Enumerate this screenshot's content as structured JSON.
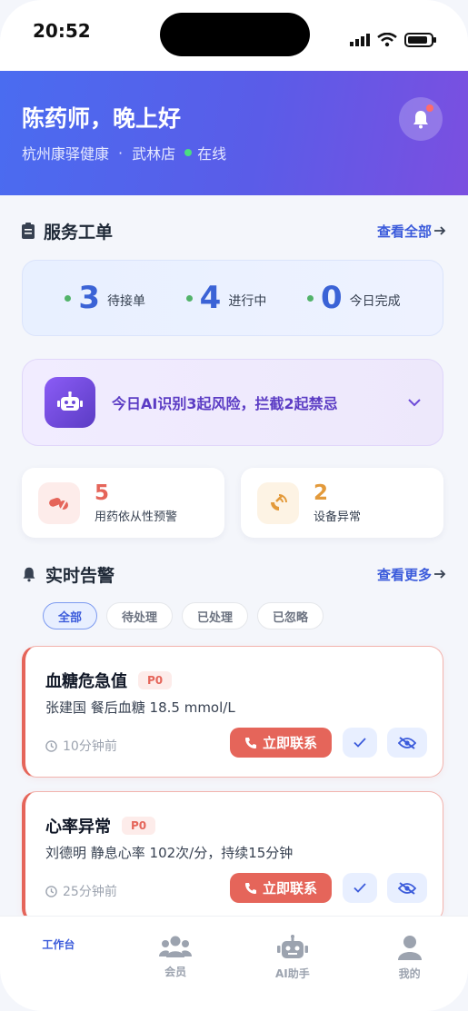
{
  "status_bar": {
    "time": "20:52"
  },
  "header": {
    "greeting": "陈药师，晚上好",
    "company": "杭州康驿健康",
    "separator": "·",
    "store": "武林店",
    "online": "在线"
  },
  "service": {
    "title": "服务工单",
    "link": "查看全部",
    "stats": [
      {
        "value": "3",
        "label": "待接单"
      },
      {
        "value": "4",
        "label": "进行中"
      },
      {
        "value": "0",
        "label": "今日完成"
      }
    ]
  },
  "ai_banner": {
    "text": "今日AI识别3起风险，拦截2起禁忌"
  },
  "mini_cards": [
    {
      "value": "5",
      "label": "用药依从性预警",
      "color": "#e5655a",
      "icon": "pill-icon"
    },
    {
      "value": "2",
      "label": "设备异常",
      "color": "#e39a3b",
      "icon": "satellite-icon"
    }
  ],
  "alerts_section": {
    "title": "实时告警",
    "link": "查看更多",
    "filters": [
      "全部",
      "待处理",
      "已处理",
      "已忽略"
    ],
    "active_filter": "全部"
  },
  "alerts": [
    {
      "title": "血糖危急值",
      "priority": "P0",
      "desc": "张建国 餐后血糖 18.5 mmol/L",
      "time": "10分钟前",
      "action": "立即联系"
    },
    {
      "title": "心率异常",
      "priority": "P0",
      "desc": "刘德明 静息心率 102次/分，持续15分钟",
      "time": "25分钟前",
      "action": "立即联系"
    }
  ],
  "tabbar": [
    {
      "label": "工作台",
      "icon": "workbench-icon"
    },
    {
      "label": "会员",
      "icon": "members-icon"
    },
    {
      "label": "AI助手",
      "icon": "robot-icon"
    },
    {
      "label": "我的",
      "icon": "profile-icon"
    }
  ],
  "colors": {
    "accent": "#3b5bdb",
    "danger": "#e5655a",
    "warning": "#e39a3b",
    "ai_purple": "#5b3cc4"
  }
}
